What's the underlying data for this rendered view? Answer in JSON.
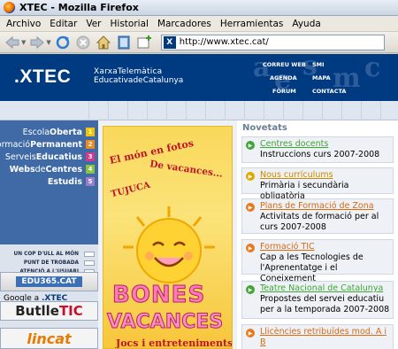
{
  "window": {
    "title": "XTEC - Mozilla Firefox"
  },
  "menu": [
    "Archivo",
    "Editar",
    "Ver",
    "Historial",
    "Marcadores",
    "Herramientas",
    "Ayuda"
  ],
  "toolbar": {
    "url": "http://www.xtec.cat/"
  },
  "header": {
    "logo": ".XTEC",
    "subtitle_line1": "XarxaTelemàtica",
    "subtitle_line2": "EducativadeCatalunya",
    "nav": [
      "CORREU WEB",
      "SMI",
      "AGENDA",
      "MAPA",
      "FÒRUM",
      "CONTACTA"
    ]
  },
  "sidebar": {
    "items": [
      {
        "pre": "Escola",
        "bold": "Oberta",
        "num": "1",
        "color": "#f5c400"
      },
      {
        "pre": "Formació",
        "bold": "Permanent",
        "num": "2",
        "color": "#f08a1c"
      },
      {
        "pre": "Serveis",
        "bold": "Educatius",
        "num": "3",
        "color": "#d63a8f"
      },
      {
        "pre": "Webs",
        "mid": "de",
        "bold": "Centres",
        "num": "4",
        "color": "#8bc23f"
      },
      {
        "pre": "",
        "bold": "Estudis",
        "num": "5",
        "color": "#9a7cc8"
      }
    ],
    "quick": [
      "UN COP D'ULL AL MÓN",
      "PUNT DE TROBADA",
      "ATENCIÓ A L'USUARI"
    ],
    "google_label": "Google a ",
    "google_site": ".XTEC",
    "banners": {
      "edu365": "EDU365.CAT",
      "butlle": "Butlle",
      "tic": "TIC",
      "lincat": "lincat"
    }
  },
  "promo": {
    "line1": "El món en fotos",
    "line2": "De vacances...",
    "line3": "TUJUCA",
    "bones": "BONES",
    "vacances": "VACANCES",
    "bottom": "Jocs i entreteniments"
  },
  "news": {
    "heading": "Novetats",
    "items": [
      {
        "title": "Centres docents",
        "desc": "Instruccions curs 2007-2008",
        "color": "#3fa535",
        "titlecolor": "#3fa535"
      },
      {
        "title": "Nous currículums",
        "desc": "Primària i secundària obligatòria",
        "color": "#e0a800",
        "titlecolor": "#c98a00"
      },
      {
        "title": "Plans de Formació de Zona",
        "desc": "Activitats de formació per al curs 2007-2008",
        "color": "#e87a1c",
        "titlecolor": "#d86a10"
      },
      {
        "title": "Formació TIC",
        "desc": "Cap a les Tecnologies de l'Aprenentatge i el Coneixement",
        "color": "#e87a1c",
        "titlecolor": "#d86a10"
      },
      {
        "title": "Teatre Nacional de Catalunya",
        "desc": "Propostes del servei educatiu per a la temporada 2007-2008",
        "color": "#3fa535",
        "titlecolor": "#3fa535"
      },
      {
        "title": "Llicències retribuïdes mod. A i B",
        "desc": "",
        "color": "#e87a1c",
        "titlecolor": "#d86a10"
      }
    ]
  }
}
